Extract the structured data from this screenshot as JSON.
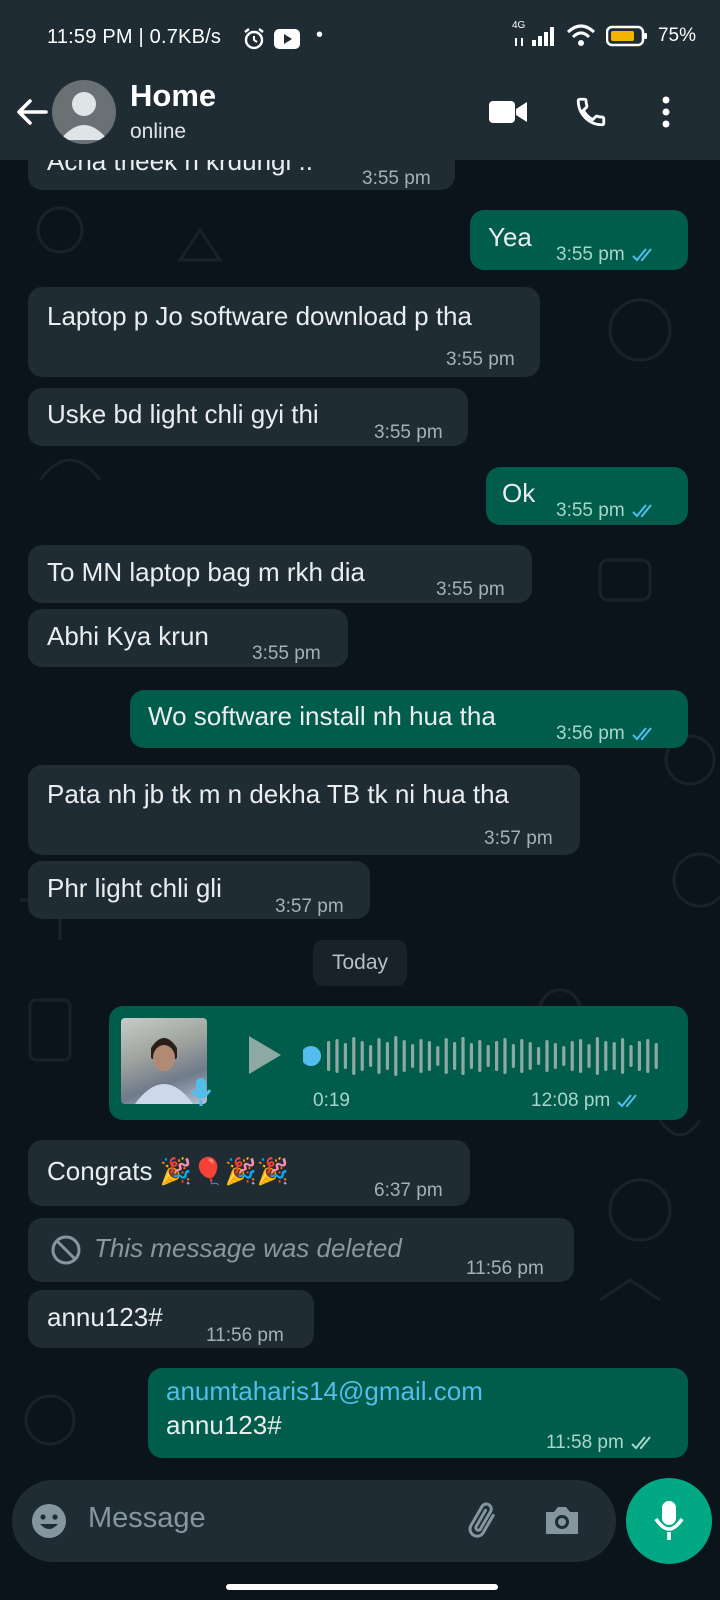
{
  "status": {
    "time": "11:59 PM | 0.7KB/s",
    "network": "4G",
    "battery": "75%"
  },
  "header": {
    "title": "Home",
    "subtitle": "online"
  },
  "messages": [
    {
      "dir": "in",
      "text": "Acha theek h krdungi ..",
      "time": "3:55 pm"
    },
    {
      "dir": "out",
      "text": "Yea",
      "time": "3:55 pm"
    },
    {
      "dir": "in",
      "text": "Laptop p Jo software download p tha",
      "time": "3:55 pm"
    },
    {
      "dir": "in",
      "text": "Uske bd light chli gyi thi",
      "time": "3:55 pm"
    },
    {
      "dir": "out",
      "text": "Ok",
      "time": "3:55 pm"
    },
    {
      "dir": "in",
      "text": "To MN laptop bag m rkh dia",
      "time": "3:55 pm"
    },
    {
      "dir": "in",
      "text": "Abhi Kya krun",
      "time": "3:55 pm"
    },
    {
      "dir": "out",
      "text": "Wo software install nh hua tha",
      "time": "3:56 pm"
    },
    {
      "dir": "in",
      "text": "Pata nh jb tk m n dekha TB tk ni hua tha",
      "time": "3:57 pm"
    },
    {
      "dir": "in",
      "text": "Phr light chli gli",
      "time": "3:57 pm"
    }
  ],
  "date_divider": "Today",
  "voice": {
    "duration": "0:19",
    "time": "12:08 pm"
  },
  "messages2": [
    {
      "dir": "in",
      "text": "Congrats 🎉🎈🎉🎉",
      "time": "6:37 pm"
    },
    {
      "dir": "in",
      "text": "This message was deleted",
      "time": "11:56 pm"
    },
    {
      "dir": "in",
      "text": "annu123#",
      "time": "11:56 pm"
    }
  ],
  "last": {
    "email": "anumtaharis14@gmail.com",
    "text": "annu123#",
    "time": "11:58 pm"
  },
  "composer": {
    "placeholder": "Message"
  },
  "colors": {
    "incoming": "#202c33",
    "outgoing": "#005c4b",
    "accent": "#00a884",
    "read_ticks": "#53bdeb",
    "link": "#53bdeb"
  }
}
